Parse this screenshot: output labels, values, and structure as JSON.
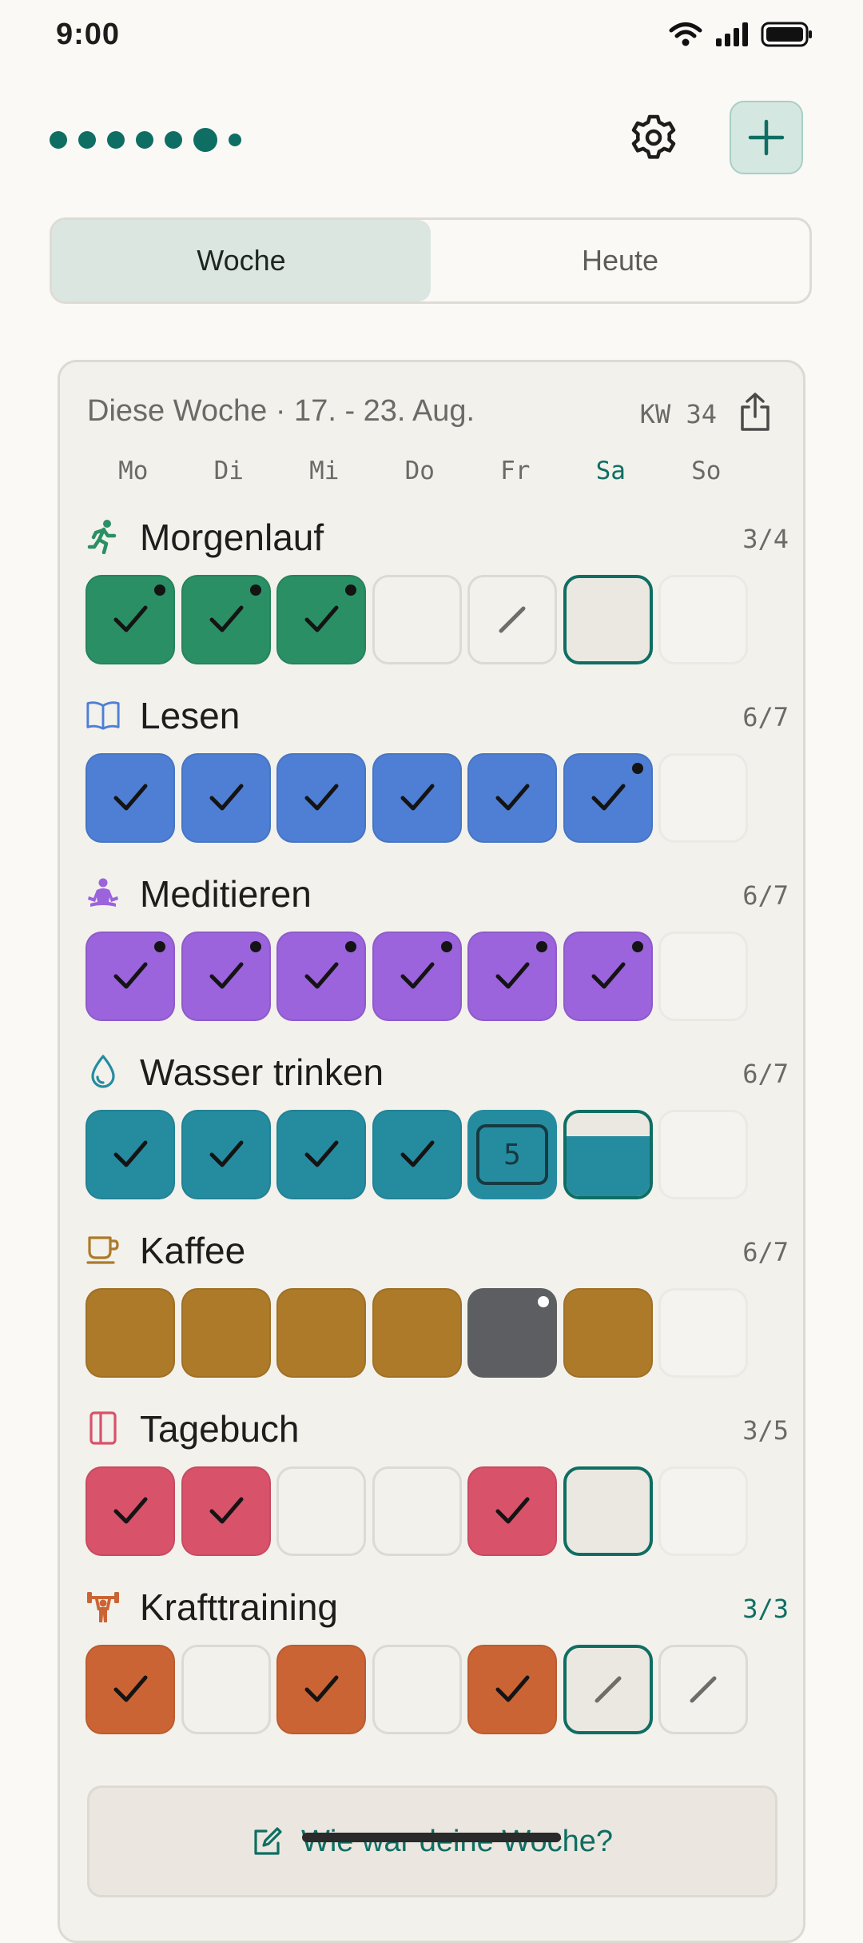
{
  "status_bar": {
    "time": "9:00"
  },
  "colors": {
    "accent": "#0f6e63"
  },
  "tabs": [
    {
      "label": "Woche",
      "active": true
    },
    {
      "label": "Heute",
      "active": false
    }
  ],
  "week": {
    "title": "Diese Woche · 17. - 23. Aug.",
    "kw": "KW 34",
    "days": [
      "Mo",
      "Di",
      "Mi",
      "Do",
      "Fr",
      "Sa",
      "So"
    ],
    "today_index": 5
  },
  "habits": [
    {
      "name": "Morgenlauf",
      "count": "3/4",
      "icon": "running-icon",
      "color": "#2a8f64",
      "complete": false,
      "cells": [
        {
          "state": "check",
          "pip": true
        },
        {
          "state": "check",
          "pip": true
        },
        {
          "state": "check",
          "pip": true
        },
        {
          "state": "empty"
        },
        {
          "state": "skip"
        },
        {
          "state": "today"
        },
        {
          "state": "future"
        }
      ]
    },
    {
      "name": "Lesen",
      "count": "6/7",
      "icon": "book-icon",
      "color": "#4e7fd4",
      "complete": false,
      "cells": [
        {
          "state": "check"
        },
        {
          "state": "check"
        },
        {
          "state": "check"
        },
        {
          "state": "check"
        },
        {
          "state": "check"
        },
        {
          "state": "check",
          "pip": true
        },
        {
          "state": "future"
        }
      ]
    },
    {
      "name": "Meditieren",
      "count": "6/7",
      "icon": "meditation-icon",
      "color": "#9b63dc",
      "complete": false,
      "cells": [
        {
          "state": "check",
          "pip": true
        },
        {
          "state": "check",
          "pip": true
        },
        {
          "state": "check",
          "pip": true
        },
        {
          "state": "check",
          "pip": true
        },
        {
          "state": "check",
          "pip": true
        },
        {
          "state": "check",
          "pip": true
        },
        {
          "state": "future"
        }
      ]
    },
    {
      "name": "Wasser trinken",
      "count": "6/7",
      "icon": "water-drop-icon",
      "color": "#258ca0",
      "complete": false,
      "cells": [
        {
          "state": "check"
        },
        {
          "state": "check"
        },
        {
          "state": "check"
        },
        {
          "state": "check"
        },
        {
          "state": "number",
          "value": "5"
        },
        {
          "state": "partial",
          "level": 0.72
        },
        {
          "state": "future"
        }
      ]
    },
    {
      "name": "Kaffee",
      "count": "6/7",
      "icon": "coffee-cup-icon",
      "color": "#ad7a29",
      "complete": false,
      "cells": [
        {
          "state": "filled"
        },
        {
          "state": "filled"
        },
        {
          "state": "filled"
        },
        {
          "state": "filled"
        },
        {
          "state": "dark",
          "pip": true
        },
        {
          "state": "filled"
        },
        {
          "state": "future"
        }
      ]
    },
    {
      "name": "Tagebuch",
      "count": "3/5",
      "icon": "journal-icon",
      "color": "#d8526a",
      "complete": false,
      "cells": [
        {
          "state": "check"
        },
        {
          "state": "check"
        },
        {
          "state": "empty"
        },
        {
          "state": "empty"
        },
        {
          "state": "check"
        },
        {
          "state": "today"
        },
        {
          "state": "future"
        }
      ]
    },
    {
      "name": "Krafttraining",
      "count": "3/3",
      "icon": "weightlifting-icon",
      "color": "#cb6434",
      "complete": true,
      "cells": [
        {
          "state": "check"
        },
        {
          "state": "empty"
        },
        {
          "state": "check"
        },
        {
          "state": "empty"
        },
        {
          "state": "check"
        },
        {
          "state": "today-skip"
        },
        {
          "state": "skip"
        }
      ]
    }
  ],
  "reflection": {
    "label": "Wie war deine Woche?"
  }
}
